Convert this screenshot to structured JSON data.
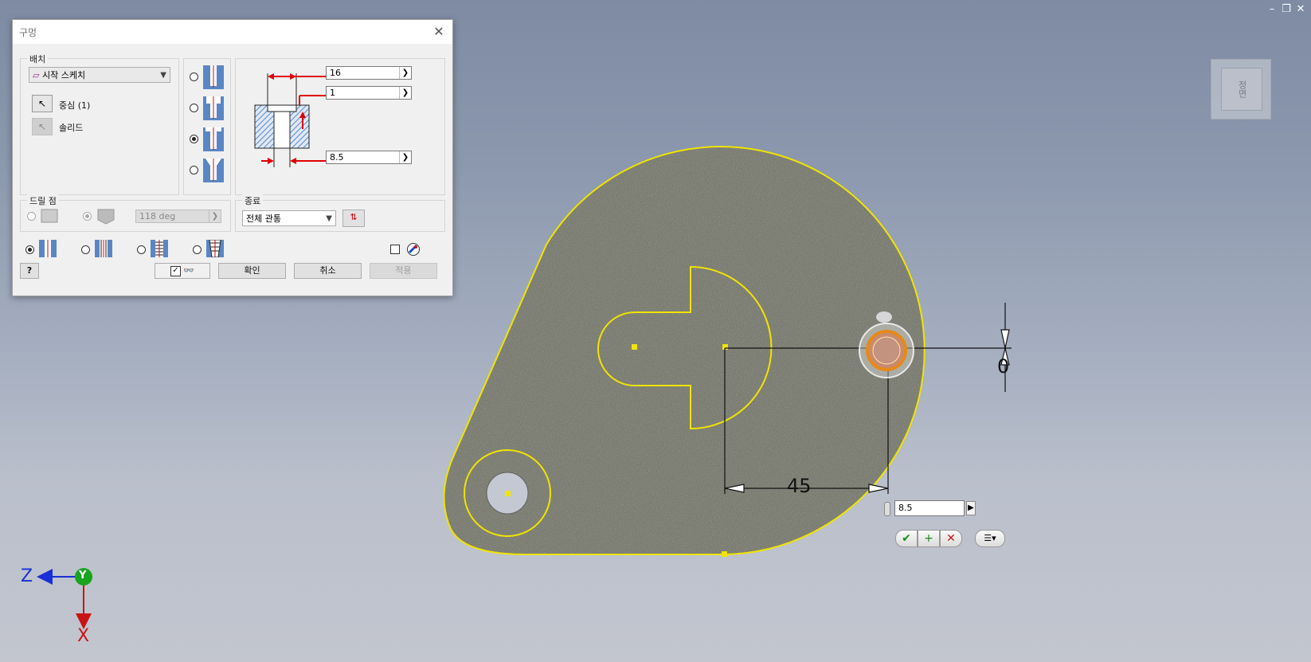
{
  "dialog": {
    "title": "구멍",
    "placement": {
      "label": "배치",
      "method": "시작 스케치",
      "center_label": "중심 (1)",
      "solid_label": "솔리드"
    },
    "dimensions": {
      "counterbore_diameter": "16",
      "counterbore_depth": "1",
      "hole_diameter": "8.5"
    },
    "drill_point": {
      "label": "드릴 점",
      "angle": "118 deg"
    },
    "termination": {
      "label": "종료",
      "value": "전체 관통"
    },
    "buttons": {
      "ok": "확인",
      "cancel": "취소",
      "apply": "적용"
    }
  },
  "canvas": {
    "dimension_horizontal": "45",
    "dimension_vertical": "0",
    "dim_input_value": "8.5",
    "viewcube_face": "정면",
    "triad": {
      "z": "Z",
      "y": "Y",
      "x": "X"
    }
  },
  "colors": {
    "sketch": "#f0e400",
    "dialog_bg": "#f0f0f0",
    "arrow_red": "#e00000",
    "hatch_blue": "#5a86c4",
    "triad_z": "#1a2fd6",
    "triad_y": "#19a31f",
    "triad_x": "#c81414"
  }
}
